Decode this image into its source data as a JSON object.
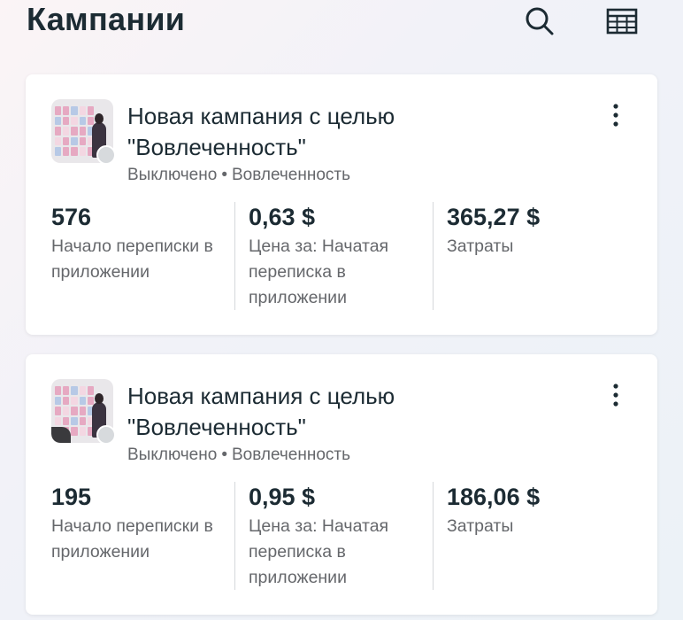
{
  "header": {
    "title": "Кампании",
    "search_icon": "search-icon",
    "table_icon": "table-icon"
  },
  "campaigns": [
    {
      "name": "Новая кампания с целью\n\"Вовлеченность\"",
      "status": "Выключено",
      "separator": "•",
      "objective": "Вовлеченность",
      "metrics": [
        {
          "value": "576",
          "label": "Начало переписки в приложении"
        },
        {
          "value": "0,63 $",
          "label": "Цена за: Начатая переписка в приложении"
        },
        {
          "value": "365,27 $",
          "label": "Затраты"
        }
      ]
    },
    {
      "name": "Новая кампания с целью\n\"Вовлеченность\"",
      "status": "Выключено",
      "separator": "•",
      "objective": "Вовлеченность",
      "metrics": [
        {
          "value": "195",
          "label": "Начало переписки в приложении"
        },
        {
          "value": "0,95 $",
          "label": "Цена за: Начатая переписка в приложении"
        },
        {
          "value": "186,06 $",
          "label": "Затраты"
        }
      ]
    }
  ],
  "colors": {
    "text_primary": "#1c2b33",
    "text_secondary": "#65676b",
    "status_off": "#d7dadd"
  }
}
